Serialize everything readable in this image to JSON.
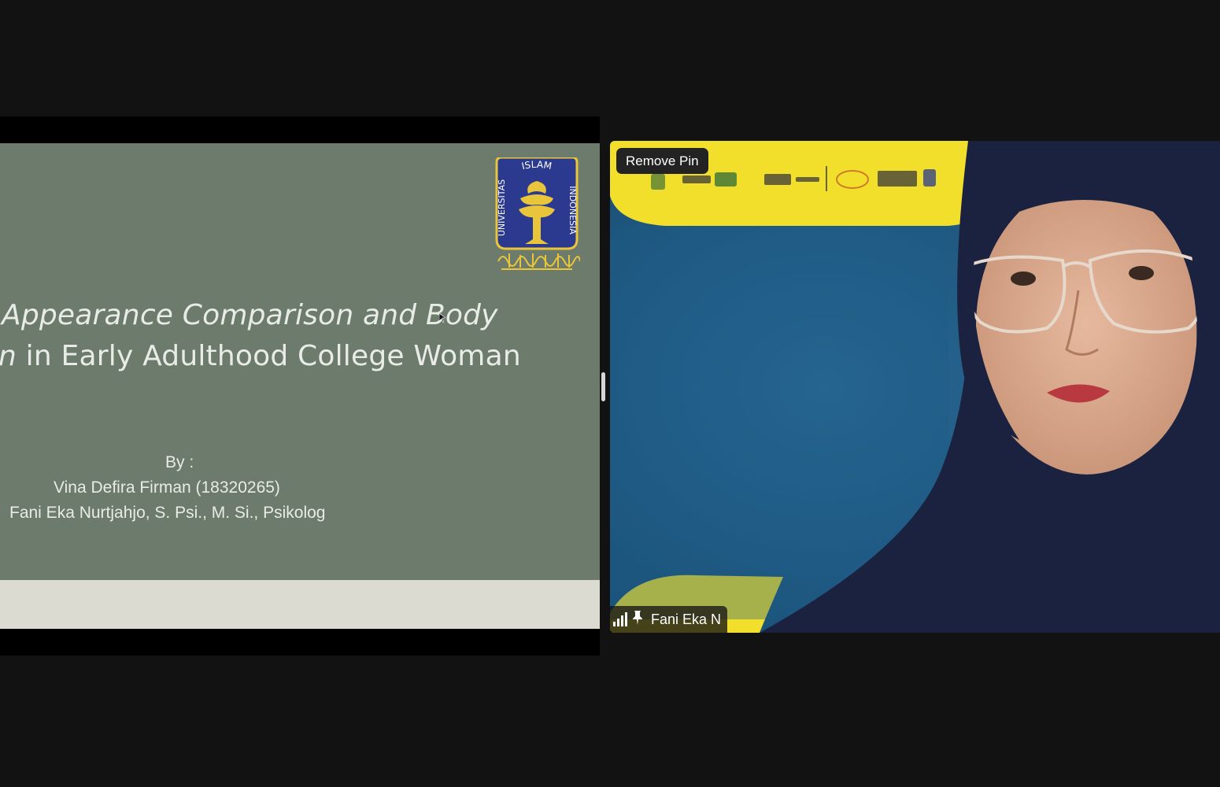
{
  "slide": {
    "title_line1": "Appearance Comparison and Body",
    "title_line2_italic": "n",
    "title_line2_rest": " in Early Adulthood College Woman",
    "by_label": "By :",
    "author1": "Vina Defira Firman (18320265)",
    "author2": "Fani Eka Nurtjahjo, S. Psi., M. Si., Psikolog",
    "logo": {
      "top_text": "ISLAM",
      "left_text": "UNIVERSITAS",
      "right_text": "INDONESIA",
      "colors": {
        "shield": "#2b3a8f",
        "gold": "#e8c53a"
      }
    }
  },
  "video": {
    "remove_pin_label": "Remove Pin",
    "participant_name": "Fani Eka N",
    "icons": [
      "signal-strength-icon",
      "pin-icon"
    ],
    "background_colors": {
      "yellow": "#f2df2b",
      "blue": "#1f5a84",
      "hijab": "#1b2240"
    }
  }
}
